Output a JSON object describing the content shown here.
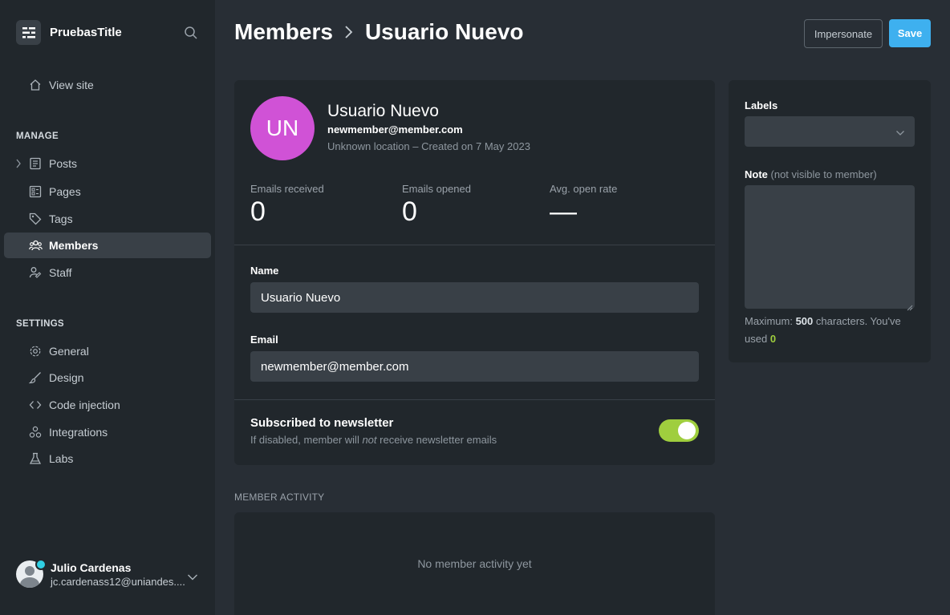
{
  "sidebar": {
    "brand": "PruebasTitle",
    "view_site": "View site",
    "manage_label": "MANAGE",
    "settings_label": "SETTINGS",
    "manage_items": [
      {
        "label": "Posts",
        "icon": "posts-icon"
      },
      {
        "label": "Pages",
        "icon": "pages-icon"
      },
      {
        "label": "Tags",
        "icon": "tag-icon"
      },
      {
        "label": "Members",
        "icon": "members-icon",
        "active": true
      },
      {
        "label": "Staff",
        "icon": "staff-icon"
      }
    ],
    "settings_items": [
      {
        "label": "General",
        "icon": "gear-icon"
      },
      {
        "label": "Design",
        "icon": "brush-icon"
      },
      {
        "label": "Code injection",
        "icon": "code-icon"
      },
      {
        "label": "Integrations",
        "icon": "integrations-icon"
      },
      {
        "label": "Labs",
        "icon": "flask-icon"
      }
    ],
    "user": {
      "name": "Julio Cardenas",
      "email": "jc.cardenass12@uniandes...."
    }
  },
  "header": {
    "parent": "Members",
    "current": "Usuario Nuevo",
    "impersonate_label": "Impersonate",
    "save_label": "Save"
  },
  "member": {
    "initials": "UN",
    "name": "Usuario Nuevo",
    "email": "newmember@member.com",
    "meta": "Unknown location – Created on 7 May 2023",
    "avatar_color": "#d052d6"
  },
  "stats": [
    {
      "label": "Emails received",
      "value": "0"
    },
    {
      "label": "Emails opened",
      "value": "0"
    },
    {
      "label": "Avg. open rate",
      "value": "—"
    }
  ],
  "form": {
    "name_label": "Name",
    "name_value": "Usuario Nuevo",
    "email_label": "Email",
    "email_value": "newmember@member.com",
    "newsletter_title": "Subscribed to newsletter",
    "newsletter_desc_before": "If disabled, member will ",
    "newsletter_desc_em": "not",
    "newsletter_desc_after": " receive newsletter emails",
    "newsletter_on": true
  },
  "activity": {
    "section_label": "MEMBER ACTIVITY",
    "empty_text": "No member activity yet"
  },
  "side": {
    "labels_label": "Labels",
    "note_label": "Note",
    "note_hint": "(not visible to member)",
    "help_prefix": "Maximum: ",
    "help_max": "500",
    "help_mid": " characters. You've used ",
    "help_used": "0"
  },
  "colors": {
    "accent": "#3eb0ef",
    "toggle_on": "#9fce3e",
    "sidebar_bg": "#21272c",
    "page_bg": "#282e35"
  }
}
